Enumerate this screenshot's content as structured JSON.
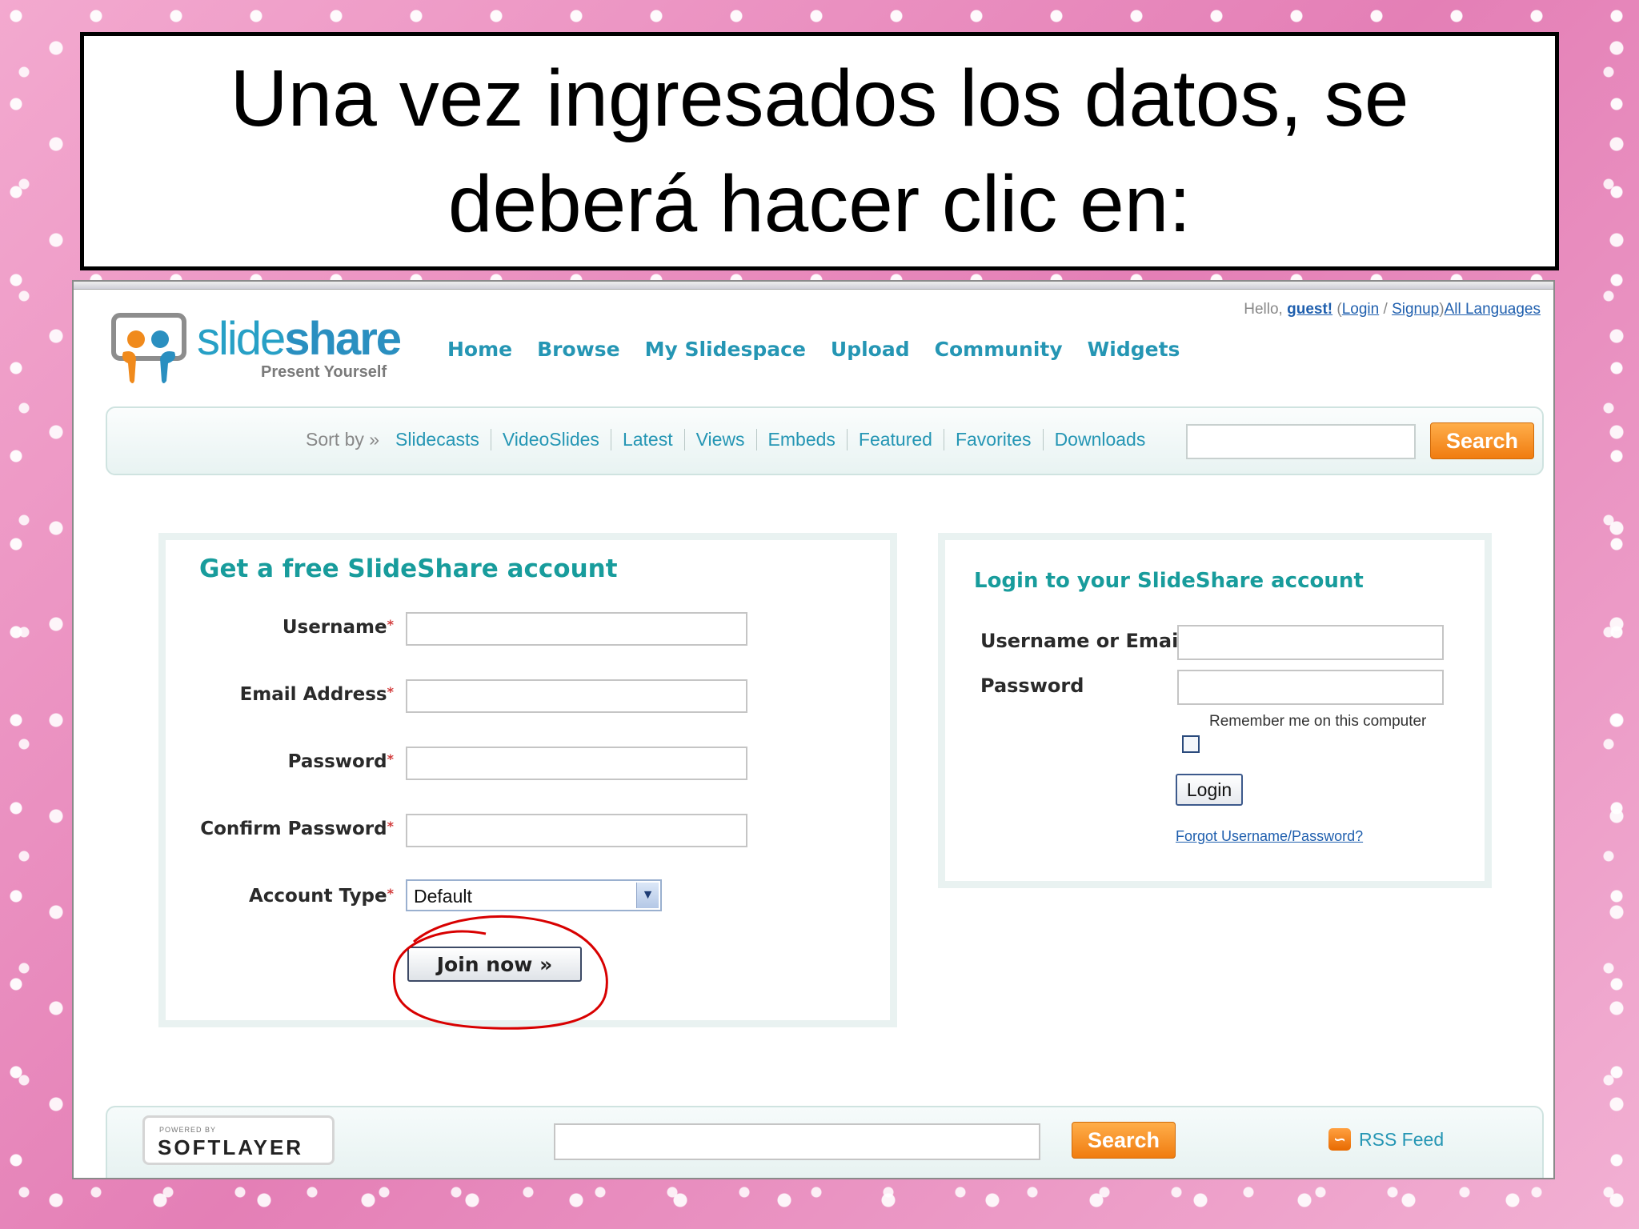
{
  "slide": {
    "title": "Una vez ingresados los datos, se deberá hacer clic en:"
  },
  "header": {
    "hello": "Hello,",
    "guest": "guest!",
    "open_paren": "(",
    "login": "Login",
    "slash": "/",
    "signup": "Signup",
    "close_paren": ")",
    "all_languages": "All Languages"
  },
  "logo": {
    "name_light": "slide",
    "name_bold": "share",
    "tagline": "Present Yourself"
  },
  "main_nav": [
    "Home",
    "Browse",
    "My Slidespace",
    "Upload",
    "Community",
    "Widgets"
  ],
  "sort_bar": {
    "label": "Sort by »",
    "items": [
      "Slidecasts",
      "VideoSlides",
      "Latest",
      "Views",
      "Embeds",
      "Featured",
      "Favorites",
      "Downloads"
    ],
    "search_button": "Search"
  },
  "signup": {
    "title": "Get a free SlideShare account",
    "username_label": "Username",
    "email_label": "Email Address",
    "password_label": "Password",
    "confirm_label": "Confirm Password",
    "account_type_label": "Account Type",
    "required_mark": "*",
    "account_type_value": "Default",
    "join_button": "Join now »"
  },
  "login": {
    "title": "Login to your SlideShare account",
    "username_label": "Username or Email",
    "password_label": "Password",
    "remember_label": "Remember me on this computer",
    "remember_checked": false,
    "login_button": "Login",
    "forgot_link": "Forgot Username/Password?"
  },
  "footer": {
    "powered_by": "POWERED BY",
    "softlayer": "SOFTLAYER",
    "search_button": "Search",
    "rss_label": "RSS Feed"
  },
  "colors": {
    "accent_teal": "#189c9c",
    "nav_blue": "#2596b4",
    "search_orange": "#f07c10",
    "annotation_red": "#d80000",
    "slide_pink": "#e58bbd"
  }
}
